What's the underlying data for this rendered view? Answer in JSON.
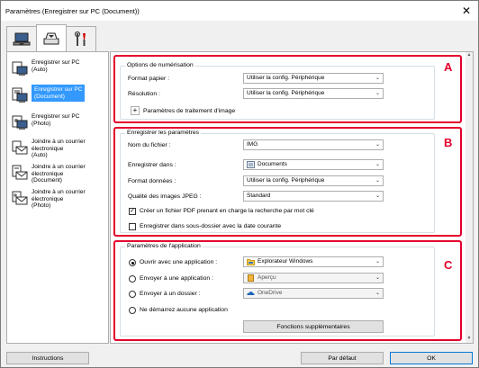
{
  "window": {
    "title": "Paramètres (Enregistrer sur PC (Document))",
    "close_glyph": "✕"
  },
  "tabs": [
    {
      "icon": "scan-from-computer-icon"
    },
    {
      "icon": "scan-from-operation-panel-icon"
    },
    {
      "icon": "general-settings-icon"
    }
  ],
  "sidebar": {
    "items": [
      {
        "label": "Enregistrer sur PC\n(Auto)",
        "icon": "save-pc-auto-icon"
      },
      {
        "label": "Enregistrer sur PC\n(Document)",
        "icon": "save-pc-document-icon",
        "selected": true
      },
      {
        "label": "Enregistrer sur PC\n(Photo)",
        "icon": "save-pc-photo-icon"
      },
      {
        "label": "Joindre à un courrier\nélectronique\n(Auto)",
        "icon": "email-auto-icon"
      },
      {
        "label": "Joindre à un courrier\nélectronique\n(Document)",
        "icon": "email-document-icon"
      },
      {
        "label": "Joindre à un courrier\nélectronique\n(Photo)",
        "icon": "email-photo-icon"
      }
    ]
  },
  "markers": {
    "a": "A",
    "b": "B",
    "c": "C"
  },
  "scan_options": {
    "title": "Options de numérisation",
    "paper_size_label": "Format papier :",
    "paper_size_value": "Utiliser la config. Périphérique",
    "resolution_label": "Résolution :",
    "resolution_value": "Utiliser la config. Périphérique",
    "image_processing_label": "Paramètres de traitement d'image",
    "plus_glyph": "+"
  },
  "save_settings": {
    "title": "Enregistrer les paramètres",
    "file_name_label": "Nom du fichier :",
    "file_name_value": "IMG",
    "save_in_label": "Enregistrer dans :",
    "save_in_value": "Documents",
    "data_format_label": "Format données :",
    "data_format_value": "Utiliser la config. Périphérique",
    "jpeg_quality_label": "Qualité des images JPEG :",
    "jpeg_quality_value": "Standard",
    "keyword_pdf_label": "Créer un fichier PDF prenant en charge la recherche par mot clé",
    "keyword_pdf_checked": true,
    "subfolder_label": "Enregistrer dans sous-dossier avec la date courante",
    "subfolder_checked": false
  },
  "app_settings": {
    "title": "Paramètres de l'application",
    "open_app_label": "Ouvrir avec une application :",
    "open_app_value": "Explorateur Windows",
    "send_app_label": "Envoyer à une application :",
    "send_app_value": "Aperçu",
    "send_folder_label": "Envoyer à un dossier :",
    "send_folder_value": "OneDrive",
    "no_app_label": "Ne démarrez aucune application",
    "more_functions_label": "Fonctions supplémentaires",
    "selected": "open_app"
  },
  "footer": {
    "instructions_label": "Instructions",
    "defaults_label": "Par défaut",
    "ok_label": "OK"
  },
  "colors": {
    "marker": "#e4002b",
    "selection": "#3399ff"
  }
}
